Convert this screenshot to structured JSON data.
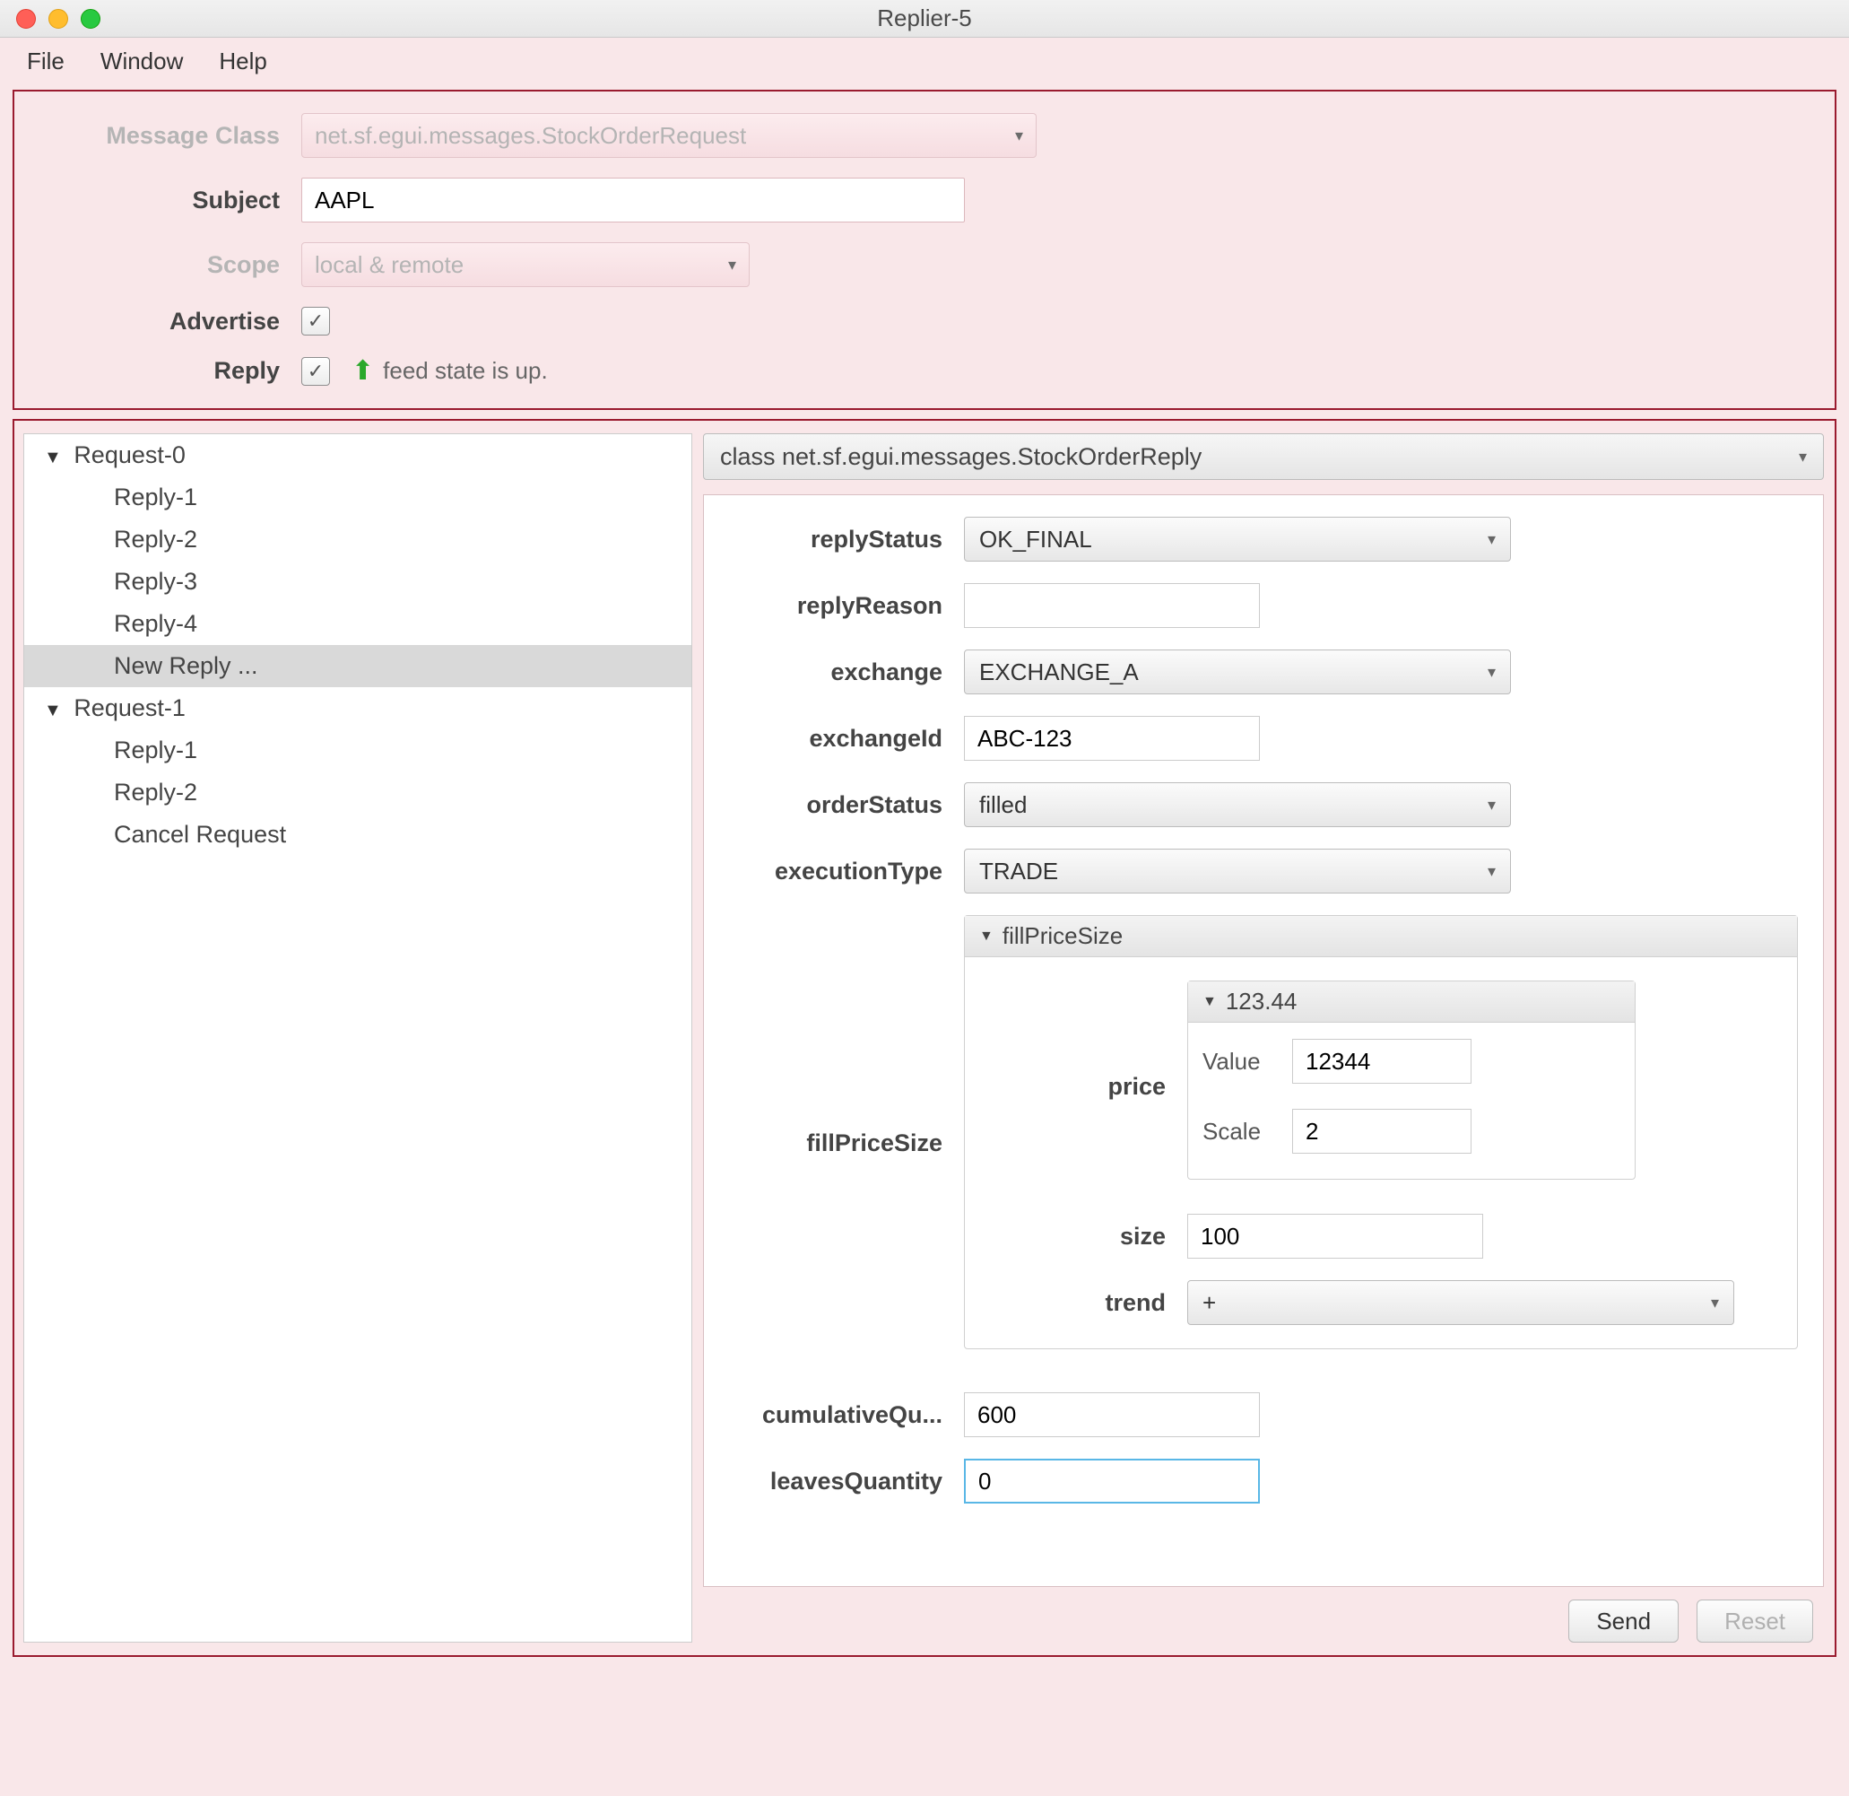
{
  "window": {
    "title": "Replier-5"
  },
  "menu": {
    "file": "File",
    "window": "Window",
    "help": "Help"
  },
  "top": {
    "messageClass_lbl": "Message Class",
    "messageClass_val": "net.sf.egui.messages.StockOrderRequest",
    "subject_lbl": "Subject",
    "subject_val": "AAPL",
    "scope_lbl": "Scope",
    "scope_val": "local & remote",
    "advertise_lbl": "Advertise",
    "reply_lbl": "Reply",
    "advertise_checked": true,
    "reply_checked": true,
    "feed_text": "feed state is up."
  },
  "tree": {
    "n0": "Request-0",
    "n0_children": [
      "Reply-1",
      "Reply-2",
      "Reply-3",
      "Reply-4",
      "New Reply ..."
    ],
    "n1": "Request-1",
    "n1_children": [
      "Reply-1",
      "Reply-2",
      "Cancel Request"
    ],
    "selected": "New Reply ..."
  },
  "classSelect": "class net.sf.egui.messages.StockOrderReply",
  "fields": {
    "replyStatus_lbl": "replyStatus",
    "replyStatus_val": "OK_FINAL",
    "replyReason_lbl": "replyReason",
    "replyReason_val": "",
    "exchange_lbl": "exchange",
    "exchange_val": "EXCHANGE_A",
    "exchangeId_lbl": "exchangeId",
    "exchangeId_val": "ABC-123",
    "orderStatus_lbl": "orderStatus",
    "orderStatus_val": "filled",
    "executionType_lbl": "executionType",
    "executionType_val": "TRADE",
    "fillPriceSize_header": "fillPriceSize",
    "fillPriceSize_lbl": "fillPriceSize",
    "price_lbl": "price",
    "price_header": "123.44",
    "price_value_lbl": "Value",
    "price_value_val": "12344",
    "price_scale_lbl": "Scale",
    "price_scale_val": "2",
    "size_lbl": "size",
    "size_val": "100",
    "trend_lbl": "trend",
    "trend_val": "+",
    "cumulativeQuantity_lbl": "cumulativeQu...",
    "cumulativeQuantity_val": "600",
    "leavesQuantity_lbl": "leavesQuantity",
    "leavesQuantity_val": "0"
  },
  "buttons": {
    "send": "Send",
    "reset": "Reset"
  }
}
